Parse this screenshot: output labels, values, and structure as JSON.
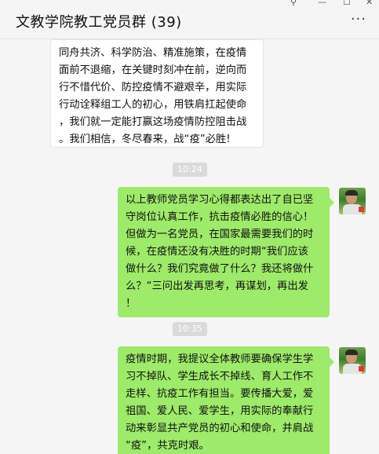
{
  "header": {
    "title": "文教学院教工党员群 (39)",
    "more_icon": "more-icon",
    "more_glyph": "···",
    "pin_glyph": "⚲",
    "minimize_glyph": "—",
    "maximize_glyph": "☐",
    "close_glyph": "✕"
  },
  "messages": {
    "first": {
      "lines": [
        "同舟共济、科学防治、精准施策，在疫情",
        "面前不退缩，在关键时刻冲在前，逆向而",
        "行不惜代价、防控疫情不避艰辛，用实际",
        "行动诠释组工人的初心，用铁肩扛起使命",
        "，我们就一定能打赢这场疫情防控阻击战",
        "。我们相信，冬尽春来，战“疫”必胜!"
      ]
    },
    "time1": "10:24",
    "second": {
      "lines": [
        "以上教师党员学习心得都表达出了自已坚",
        "守岗位认真工作，抗击疫情必胜的信心！",
        "但做为一名党员，在国家最需要我们的时",
        "候，在疫情还没有决胜的时期“我们应该",
        "做什么？我们究竟做了什么？我还将做什",
        "么？“三问出发再思考，再谋划，再出发",
        "！"
      ]
    },
    "time2": "10:35",
    "third": {
      "lines": [
        "疫情时期，我提议全体教师要确保学生学",
        "习不掉队、学生成长不掉线、育人工作不",
        "走样、抗疫工作有担当。要传播大爱，爱",
        "祖国、爱人民、爱学生，用实际的奉献行",
        "动来彰显共产党员的初心和使命，并肩战",
        "“疫”，共克时艰。"
      ]
    }
  },
  "colors": {
    "self_bubble": "#9eea6a",
    "other_bubble": "#ffffff",
    "time_badge": "#dadada"
  }
}
